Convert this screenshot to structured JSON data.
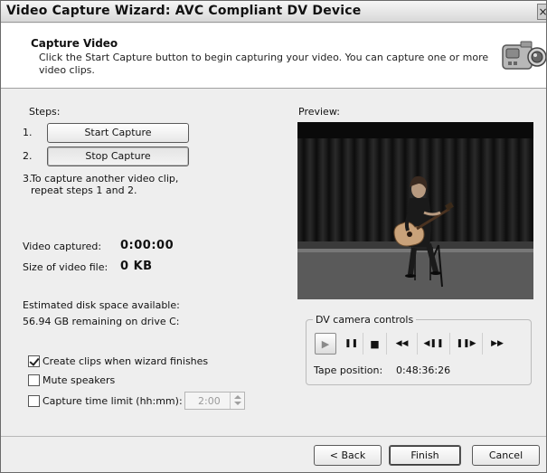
{
  "window": {
    "title": "Video Capture Wizard: AVC Compliant DV Device",
    "close_glyph": "×"
  },
  "header": {
    "title": "Capture Video",
    "description": "Click the Start Capture button to begin capturing your video. You can capture one or more video clips.",
    "icon": "camcorder-icon"
  },
  "steps": {
    "label": "Steps:",
    "step1_num": "1.",
    "step2_num": "2.",
    "step3_num": "3.",
    "start_capture_label": "Start Capture",
    "stop_capture_label": "Stop Capture",
    "step3_text": "To capture another video clip, repeat steps 1 and 2."
  },
  "stats": {
    "video_captured_label": "Video captured:",
    "video_captured_value": "0:00:00",
    "file_size_label": "Size of video file:",
    "file_size_value": "0 KB",
    "disk_label": "Estimated disk space available:",
    "disk_value": "56.94 GB remaining on drive C:"
  },
  "options": {
    "create_clips_label": "Create clips when wizard finishes",
    "create_clips_checked": true,
    "mute_label": "Mute speakers",
    "mute_checked": false,
    "time_limit_label": "Capture time limit (hh:mm):",
    "time_limit_checked": false,
    "time_limit_value": "2:00"
  },
  "preview": {
    "label": "Preview:"
  },
  "dv": {
    "legend": "DV camera controls",
    "buttons": [
      {
        "icon": "play-icon",
        "glyph": "▶"
      },
      {
        "icon": "pause-icon",
        "glyph": "❚❚"
      },
      {
        "icon": "stop-icon",
        "glyph": "■"
      },
      {
        "icon": "rewind-icon",
        "glyph": "◀◀"
      },
      {
        "icon": "step-back-icon",
        "glyph": "◀❚❚"
      },
      {
        "icon": "step-forward-icon",
        "glyph": "❚❚▶"
      },
      {
        "icon": "fast-forward-icon",
        "glyph": "▶▶"
      }
    ],
    "tape_label": "Tape position:",
    "tape_value": "0:48:36:26"
  },
  "footer": {
    "back_label": "< Back",
    "finish_label": "Finish",
    "cancel_label": "Cancel"
  }
}
